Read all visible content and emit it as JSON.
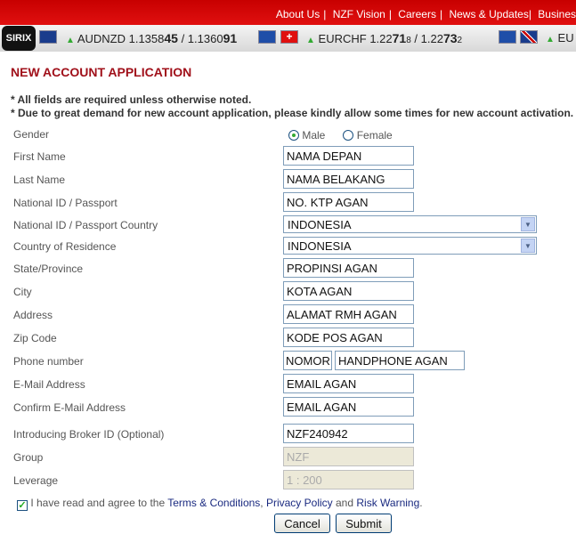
{
  "nav": {
    "links": [
      "About Us",
      "NZF Vision",
      "Careers",
      "News & Updates",
      "Busines"
    ]
  },
  "ticker": {
    "logo": "SIRIX",
    "items": [
      {
        "pair": "AUDNZD",
        "bid_a": "1.1358",
        "bid_b": "45",
        "ask_a": "1.1360",
        "ask_b": "91",
        "bid_c": "",
        "ask_c": ""
      },
      {
        "pair": "EURCHF",
        "bid_a": "1.22",
        "bid_b": "71",
        "bid_c": "8",
        "ask_a": "1.22",
        "ask_b": "73",
        "ask_c": "2"
      },
      {
        "pair": "EU"
      }
    ]
  },
  "title": "NEW ACCOUNT APPLICATION",
  "notes": [
    "* All fields are required unless otherwise noted.",
    "* Due to great demand for new account application, please kindly allow some times for new account activation."
  ],
  "form": {
    "gender": {
      "label": "Gender",
      "options": [
        "Male",
        "Female"
      ],
      "selected": "Male"
    },
    "first_name": {
      "label": "First Name",
      "value": "NAMA DEPAN"
    },
    "last_name": {
      "label": "Last Name",
      "value": "NAMA BELAKANG"
    },
    "national_id": {
      "label": "National ID / Passport",
      "value": "NO. KTP AGAN"
    },
    "id_country": {
      "label": "National ID / Passport Country",
      "value": "INDONESIA"
    },
    "residence": {
      "label": "Country of Residence",
      "value": "INDONESIA"
    },
    "state": {
      "label": "State/Province",
      "value": "PROPINSI AGAN"
    },
    "city": {
      "label": "City",
      "value": "KOTA AGAN"
    },
    "address": {
      "label": "Address",
      "value": "ALAMAT RMH AGAN"
    },
    "zip": {
      "label": "Zip Code",
      "value": "KODE POS AGAN"
    },
    "phone": {
      "label": "Phone number",
      "prefix": "NOMOR",
      "value": "HANDPHONE AGAN"
    },
    "email": {
      "label": "E-Mail Address",
      "value": "EMAIL AGAN"
    },
    "confirm_email": {
      "label": "Confirm E-Mail Address",
      "value": "EMAIL AGAN"
    },
    "broker": {
      "label": "Introducing Broker ID (Optional)",
      "value": "NZF240942"
    },
    "group": {
      "label": "Group",
      "value": "NZF"
    },
    "leverage": {
      "label": "Leverage",
      "value": "1 : 200"
    },
    "agree": {
      "checked": true,
      "text1": "I have read and agree to the ",
      "terms": "Terms & Conditions",
      "comma": ", ",
      "privacy": "Privacy Policy",
      "and": " and ",
      "risk": "Risk Warning",
      "end": "."
    }
  },
  "buttons": {
    "cancel": "Cancel",
    "submit": "Submit"
  }
}
